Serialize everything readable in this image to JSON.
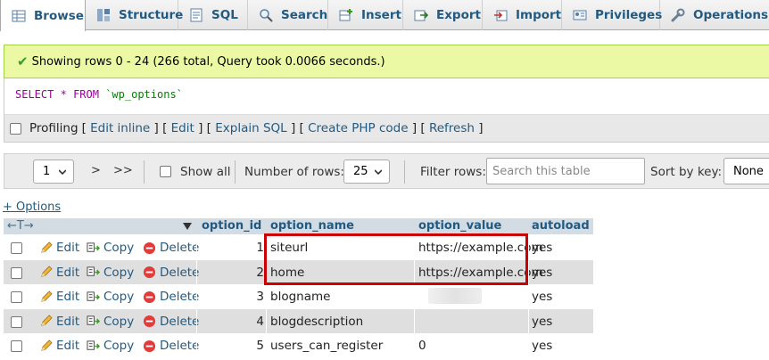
{
  "tabs": [
    {
      "label": "Browse",
      "icon": "browse-table-icon"
    },
    {
      "label": "Structure",
      "icon": "structure-icon"
    },
    {
      "label": "SQL",
      "icon": "sql-icon"
    },
    {
      "label": "Search",
      "icon": "search-icon"
    },
    {
      "label": "Insert",
      "icon": "insert-icon"
    },
    {
      "label": "Export",
      "icon": "export-icon"
    },
    {
      "label": "Import",
      "icon": "import-icon"
    },
    {
      "label": "Privileges",
      "icon": "privileges-icon"
    },
    {
      "label": "Operations",
      "icon": "wrench-icon"
    }
  ],
  "message": {
    "text": "Showing rows 0 - 24 (266 total, Query took 0.0066 seconds.)",
    "icon": "check-icon"
  },
  "sql": {
    "select": "SELECT",
    "star": "*",
    "from": "FROM",
    "table": "`wp_options`"
  },
  "tools": {
    "profiling": "Profiling",
    "links": [
      "Edit inline",
      "Edit",
      "Explain SQL",
      "Create PHP code",
      "Refresh"
    ]
  },
  "nav": {
    "page": "1",
    "next": ">",
    "last": ">>",
    "show_all": "Show all",
    "num_rows_label": "Number of rows:",
    "num_rows": "25",
    "filter_label": "Filter rows:",
    "filter_placeholder": "Search this table",
    "sort_label": "Sort by key:",
    "sort_value": "None"
  },
  "options_link": "+ Options",
  "table": {
    "arrows": "←T→",
    "columns": [
      "option_id",
      "option_name",
      "option_value",
      "autoload"
    ],
    "actions": {
      "edit": "Edit",
      "copy": "Copy",
      "delete": "Delete"
    },
    "rows": [
      {
        "option_id": "1",
        "option_name": "siteurl",
        "option_value": "https://example.com",
        "autoload": "yes"
      },
      {
        "option_id": "2",
        "option_name": "home",
        "option_value": "https://example.com",
        "autoload": "yes"
      },
      {
        "option_id": "3",
        "option_name": "blogname",
        "option_value": "",
        "autoload": "yes"
      },
      {
        "option_id": "4",
        "option_name": "blogdescription",
        "option_value": "",
        "autoload": "yes"
      },
      {
        "option_id": "5",
        "option_name": "users_can_register",
        "option_value": "0",
        "autoload": "yes"
      }
    ]
  },
  "colors": {
    "link": "#235a81",
    "success_bg": "#ebf8a4",
    "highlight": "#cc0000"
  }
}
